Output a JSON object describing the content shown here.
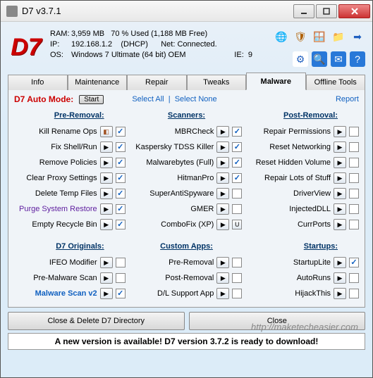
{
  "window": {
    "title": "D7  v3.7.1"
  },
  "sysinfo": {
    "ram_label": "RAM:",
    "ram_value": "3,959 MB",
    "ram_usage": "70 % Used  (1,188 MB Free)",
    "ip_label": "IP:",
    "ip_value": "192.168.1.2",
    "ip_mode": "(DHCP)",
    "net_label": "Net:",
    "net_value": "Connected.",
    "os_label": "OS:",
    "os_value": "Windows 7 Ultimate   (64 bit) OEM",
    "ie_label": "IE:",
    "ie_value": "9"
  },
  "logo": "D7",
  "tabs": [
    "Info",
    "Maintenance",
    "Repair",
    "Tweaks",
    "Malware",
    "Offline Tools"
  ],
  "active_tab": 4,
  "automode": {
    "label": "D7 Auto Mode:",
    "button": "Start"
  },
  "links": {
    "select_all": "Select All",
    "select_none": "Select None",
    "report": "Report"
  },
  "headers": {
    "pre": "Pre-Removal:",
    "scanners": "Scanners:",
    "post": "Post-Removal:",
    "originals": "D7 Originals:",
    "custom": "Custom Apps:",
    "startups": "Startups:"
  },
  "pre_removal": [
    {
      "label": "Kill Rename Ops",
      "checked": true,
      "special": true
    },
    {
      "label": "Fix Shell/Run",
      "checked": true
    },
    {
      "label": "Remove Policies",
      "checked": true
    },
    {
      "label": "Clear Proxy Settings",
      "checked": true
    },
    {
      "label": "Delete Temp Files",
      "checked": true
    },
    {
      "label": "Purge System Restore",
      "checked": true,
      "purple": true
    },
    {
      "label": "Empty Recycle Bin",
      "checked": true
    }
  ],
  "scanners": [
    {
      "label": "MBRCheck",
      "checked": true
    },
    {
      "label": "Kaspersky TDSS Killer",
      "checked": true
    },
    {
      "label": "Malwarebytes (Full)",
      "checked": true
    },
    {
      "label": "HitmanPro",
      "checked": true
    },
    {
      "label": "SuperAntiSpyware",
      "checked": false
    },
    {
      "label": "GMER",
      "checked": false
    },
    {
      "label": "ComboFix (XP)",
      "checked": false,
      "u": true
    }
  ],
  "post_removal": [
    {
      "label": "Repair Permissions",
      "checked": false
    },
    {
      "label": "Reset Networking",
      "checked": false
    },
    {
      "label": "Reset Hidden Volume",
      "checked": false
    },
    {
      "label": "Repair Lots of Stuff",
      "checked": false
    },
    {
      "label": "DriverView",
      "checked": false
    },
    {
      "label": "InjectedDLL",
      "checked": false
    },
    {
      "label": "CurrPorts",
      "checked": false
    }
  ],
  "originals": [
    {
      "label": "IFEO Modifier",
      "checked": false
    },
    {
      "label": "Pre-Malware Scan",
      "checked": false
    },
    {
      "label": "Malware Scan v2",
      "checked": true,
      "blue": true
    }
  ],
  "custom": [
    {
      "label": "Pre-Removal",
      "checked": false
    },
    {
      "label": "Post-Removal",
      "checked": false
    },
    {
      "label": "D/L Support App",
      "checked": false
    }
  ],
  "startups": [
    {
      "label": "StartupLite",
      "checked": true
    },
    {
      "label": "AutoRuns",
      "checked": false
    },
    {
      "label": "HijackThis",
      "checked": false
    }
  ],
  "buttons": {
    "close_delete": "Close & Delete D7 Directory",
    "close": "Close"
  },
  "footer": "A new version is available!  D7 version 3.7.2 is ready to download!",
  "watermark": "http://maketecheasier.com",
  "icons": {
    "globe": "🌐",
    "badge": "🛡",
    "win": "🪟",
    "folder": "📁",
    "arrow": "➡",
    "gear": "⚙",
    "search": "🔍",
    "mail": "✉",
    "help": "?"
  },
  "icon_colors": {
    "globe": "#3a78c8",
    "badge": "#b06000",
    "win": "#2a9000",
    "folder": "#d8a030",
    "arrow": "#2060c0",
    "gear_bg": "#ffffff",
    "gear_fg": "#2060c0",
    "search": "#2878d8",
    "mail": "#2878d8",
    "help": "#2878d8"
  }
}
